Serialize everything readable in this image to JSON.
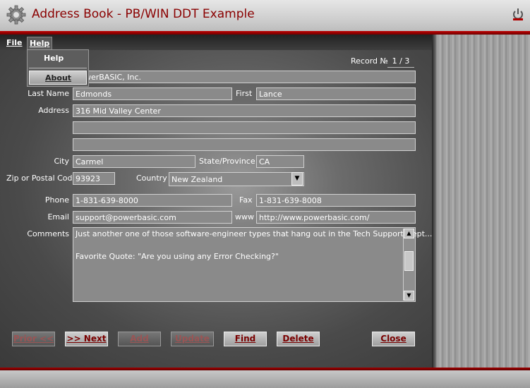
{
  "window": {
    "title": "Address Book - PB/WIN DDT Example",
    "title_color": "#8a0000",
    "accent": "#c00000"
  },
  "menu": {
    "file": "File",
    "help": "Help"
  },
  "help_menu": {
    "items": [
      "Help",
      "About"
    ]
  },
  "record": {
    "label": "Record №",
    "value": "1 / 3"
  },
  "fields": {
    "company_value": "PowerBASIC, Inc.",
    "last_name": {
      "label": "Last Name",
      "value": "Edmonds"
    },
    "first": {
      "label": "First",
      "value": "Lance"
    },
    "address": {
      "label": "Address",
      "line1": "316 Mid Valley Center",
      "line2": "",
      "line3": ""
    },
    "city": {
      "label": "City",
      "value": "Carmel"
    },
    "state": {
      "label": "State/Province",
      "value": "CA"
    },
    "zip": {
      "label": "Zip or Postal Code",
      "value": "93923"
    },
    "country": {
      "label": "Country",
      "value": "New Zealand"
    },
    "phone": {
      "label": "Phone",
      "value": "1-831-639-8000"
    },
    "fax": {
      "label": "Fax",
      "value": "1-831-639-8008"
    },
    "email": {
      "label": "Email",
      "value": "support@powerbasic.com"
    },
    "www": {
      "label": "www",
      "value": "http://www.powerbasic.com/"
    },
    "comments": {
      "label": "Comments",
      "line1": "Just another one of those software-engineer types that hang out in the Tech Support Dept...",
      "line2": "Favorite Quote: \"Are you using any Error Checking?\""
    }
  },
  "buttons": {
    "prior": "Prior <<",
    "next": ">> Next",
    "add": "Add",
    "update": "Update",
    "find": "Find",
    "delete": "Delete",
    "close": "Close"
  }
}
